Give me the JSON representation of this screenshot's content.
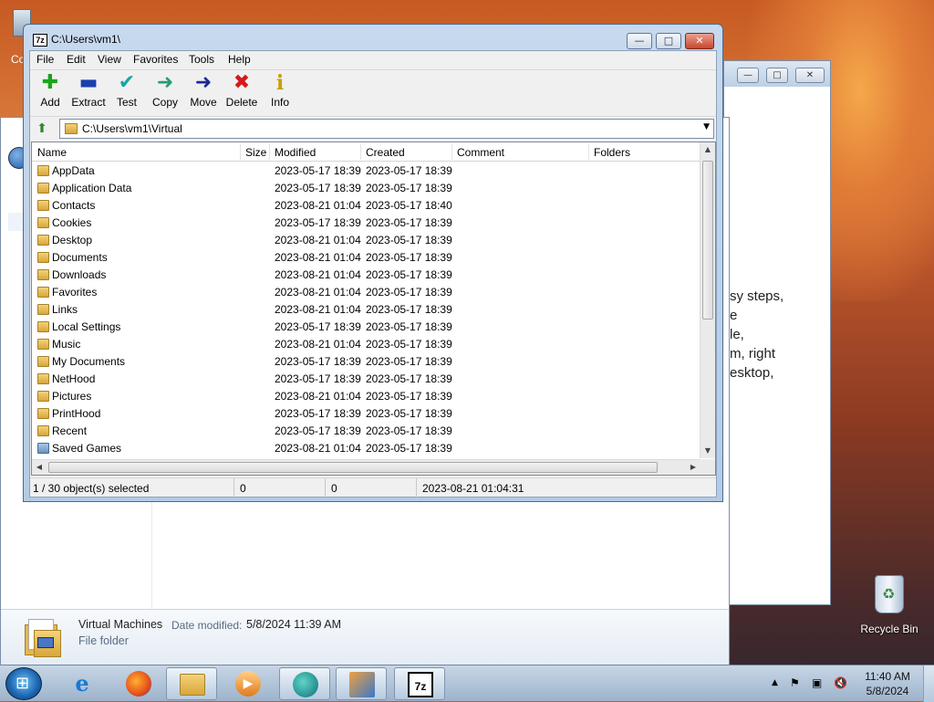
{
  "desktop": {
    "top_left_label": "Co",
    "recycle_bin_label": "Recycle Bin",
    "bg_window_text": [
      "sy steps,",
      "e",
      "le,",
      "m, right",
      "esktop,"
    ],
    "bg_window2_controls": [
      "—",
      "□",
      "✕"
    ]
  },
  "explorer_details": {
    "name": "Virtual Machines",
    "modified_label": "Date modified:",
    "modified_value": "5/8/2024 11:39 AM",
    "type": "File folder"
  },
  "window": {
    "title": "C:\\Users\\vm1\\",
    "logo": "7z",
    "controls": {
      "minimize": "—",
      "maximize": "□",
      "close": "✕"
    }
  },
  "menu": [
    "File",
    "Edit",
    "View",
    "Favorites",
    "Tools",
    "Help"
  ],
  "toolbar": [
    {
      "label": "Add",
      "icon": "plus-icon",
      "glyph": "✚",
      "color": "#1aa51a"
    },
    {
      "label": "Extract",
      "icon": "minus-icon",
      "glyph": "▬",
      "color": "#1a3fb0"
    },
    {
      "label": "Test",
      "icon": "checkmark-icon",
      "glyph": "✔",
      "color": "#1aa5a5"
    },
    {
      "label": "Copy",
      "icon": "arrow-right-icon",
      "glyph": "➜",
      "color": "#2a9a7a"
    },
    {
      "label": "Move",
      "icon": "arrow-right-icon",
      "glyph": "➜",
      "color": "#1a2a90"
    },
    {
      "label": "Delete",
      "icon": "x-icon",
      "glyph": "✖",
      "color": "#d41a1a"
    },
    {
      "label": "Info",
      "icon": "info-icon",
      "glyph": "i",
      "color": "#c7a000"
    }
  ],
  "address": {
    "value": "C:\\Users\\vm1\\Virtual "
  },
  "columns": [
    "Name",
    "Size",
    "Modified",
    "Created",
    "Comment",
    "Folders"
  ],
  "rows": [
    {
      "name": "AppData",
      "modified": "2023-05-17 18:39",
      "created": "2023-05-17 18:39",
      "icon": "folder"
    },
    {
      "name": "Application Data",
      "modified": "2023-05-17 18:39",
      "created": "2023-05-17 18:39",
      "icon": "folder"
    },
    {
      "name": "Contacts",
      "modified": "2023-08-21 01:04",
      "created": "2023-05-17 18:40",
      "icon": "folder"
    },
    {
      "name": "Cookies",
      "modified": "2023-05-17 18:39",
      "created": "2023-05-17 18:39",
      "icon": "folder"
    },
    {
      "name": "Desktop",
      "modified": "2023-08-21 01:04",
      "created": "2023-05-17 18:39",
      "icon": "folder"
    },
    {
      "name": "Documents",
      "modified": "2023-08-21 01:04",
      "created": "2023-05-17 18:39",
      "icon": "folder"
    },
    {
      "name": "Downloads",
      "modified": "2023-08-21 01:04",
      "created": "2023-05-17 18:39",
      "icon": "folder"
    },
    {
      "name": "Favorites",
      "modified": "2023-08-21 01:04",
      "created": "2023-05-17 18:39",
      "icon": "folder"
    },
    {
      "name": "Links",
      "modified": "2023-08-21 01:04",
      "created": "2023-05-17 18:39",
      "icon": "folder"
    },
    {
      "name": "Local Settings",
      "modified": "2023-05-17 18:39",
      "created": "2023-05-17 18:39",
      "icon": "folder"
    },
    {
      "name": "Music",
      "modified": "2023-08-21 01:04",
      "created": "2023-05-17 18:39",
      "icon": "folder"
    },
    {
      "name": "My Documents",
      "modified": "2023-05-17 18:39",
      "created": "2023-05-17 18:39",
      "icon": "folder"
    },
    {
      "name": "NetHood",
      "modified": "2023-05-17 18:39",
      "created": "2023-05-17 18:39",
      "icon": "folder"
    },
    {
      "name": "Pictures",
      "modified": "2023-08-21 01:04",
      "created": "2023-05-17 18:39",
      "icon": "folder"
    },
    {
      "name": "PrintHood",
      "modified": "2023-05-17 18:39",
      "created": "2023-05-17 18:39",
      "icon": "folder"
    },
    {
      "name": "Recent",
      "modified": "2023-05-17 18:39",
      "created": "2023-05-17 18:39",
      "icon": "folder"
    },
    {
      "name": "Saved Games",
      "modified": "2023-08-21 01:04",
      "created": "2023-05-17 18:39",
      "icon": "folder-blue"
    }
  ],
  "status": {
    "selection": "1 / 30 object(s) selected",
    "size": "0",
    "packed": "0",
    "datetime": "2023-08-21 01:04:31"
  },
  "taskbar": {
    "items": [
      "internet-explorer-icon",
      "firefox-icon",
      "file-explorer-icon",
      "media-player-icon",
      "app-icon",
      "windows-icon",
      "7zip-icon"
    ],
    "seven_zip_label": "7z",
    "tray_icons": [
      "▲",
      "⚑",
      "▣",
      "🔇"
    ],
    "time": "11:40 AM",
    "date": "5/8/2024"
  }
}
